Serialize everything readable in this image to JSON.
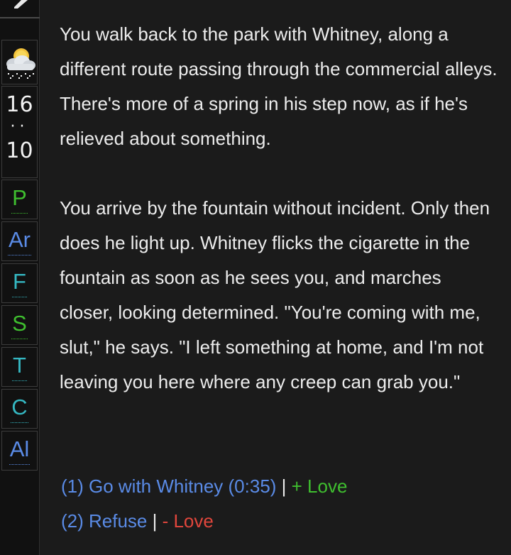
{
  "sidebar": {
    "top_icon": "pencil-icon",
    "weather_icon": "partly-cloudy-snow-icon",
    "clock": {
      "hour": "16",
      "minute": "10"
    },
    "stats": [
      {
        "label": "P",
        "color": "#3fbf2f"
      },
      {
        "label": "Ar",
        "color": "#5a8be6"
      },
      {
        "label": "F",
        "color": "#35b8c2"
      },
      {
        "label": "S",
        "color": "#3fbf2f"
      },
      {
        "label": "T",
        "color": "#35b8c2"
      },
      {
        "label": "C",
        "color": "#35b8c2"
      },
      {
        "label": "Al",
        "color": "#5a8be6"
      }
    ]
  },
  "passage": {
    "paragraph1": "You walk back to the park with Whitney, along a different route passing through the commercial alleys. There's more of a spring in his step now, as if he's relieved about something.",
    "paragraph2": "You arrive by the fountain without incident. Only then does he light up. Whitney flicks the cigarette in the fountain as soon as he sees you, and marches closer, looking determined. \"You're coming with me, slut,\" he says. \"I left something at home, and I'm not leaving you here where any creep can grab you.\""
  },
  "choices": [
    {
      "link": "(1) Go with Whitney (0:35)",
      "separator": " | ",
      "effect": "+ Love",
      "effect_color": "#3fbf2f"
    },
    {
      "link": "(2) Refuse",
      "separator": " | ",
      "effect": "- Love",
      "effect_color": "#e0463c"
    }
  ]
}
